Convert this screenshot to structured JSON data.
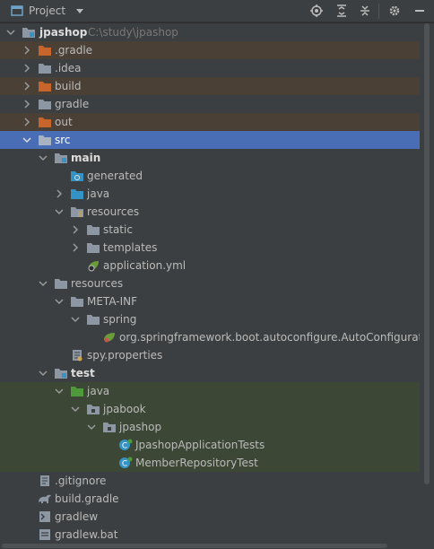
{
  "header": {
    "title": "Project",
    "icons": [
      "project-view-icon",
      "dropdown-icon",
      "locate-icon",
      "expand-all-icon",
      "collapse-all-icon",
      "settings-icon",
      "hide-icon"
    ]
  },
  "tree": {
    "root": {
      "name": "jpashop",
      "path": "C:\\study\\jpashop"
    },
    "items": [
      {
        "label": ".gradle"
      },
      {
        "label": ".idea"
      },
      {
        "label": "build"
      },
      {
        "label": "gradle"
      },
      {
        "label": "out"
      },
      {
        "label": "src"
      },
      {
        "label": "main"
      },
      {
        "label": "generated"
      },
      {
        "label": "java"
      },
      {
        "label": "resources"
      },
      {
        "label": "static"
      },
      {
        "label": "templates"
      },
      {
        "label": "application.yml"
      },
      {
        "label": "resources"
      },
      {
        "label": "META-INF"
      },
      {
        "label": "spring"
      },
      {
        "label": "org.springframework.boot.autoconfigure.AutoConfiguration.imports"
      },
      {
        "label": "spy.properties"
      },
      {
        "label": "test"
      },
      {
        "label": "java"
      },
      {
        "label": "jpabook"
      },
      {
        "label": "jpashop"
      },
      {
        "label": "JpashopApplicationTests"
      },
      {
        "label": "MemberRepositoryTest"
      },
      {
        "label": ".gitignore"
      },
      {
        "label": "build.gradle"
      },
      {
        "label": "gradlew"
      },
      {
        "label": "gradlew.bat"
      }
    ]
  },
  "colors": {
    "background": "#3c3f41",
    "excluded_row": "#4b4036",
    "selected_row": "#4a6eb5",
    "test_row": "#3c4736",
    "folder": "#8c97a3",
    "excluded_folder": "#c7652c",
    "test_folder": "#4e9a3a",
    "source_folder": "#3592c4"
  }
}
